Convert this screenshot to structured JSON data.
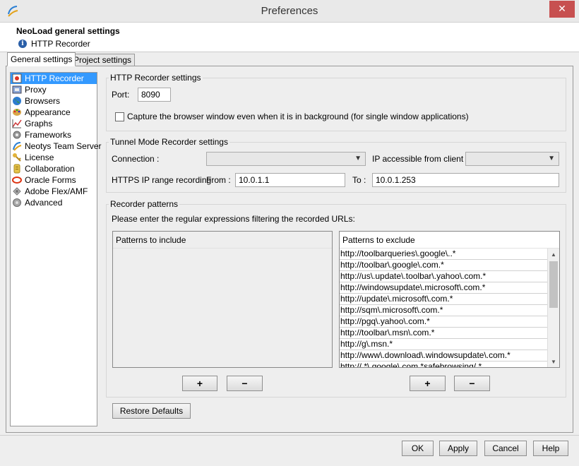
{
  "window": {
    "title": "Preferences",
    "close_glyph": "✕"
  },
  "header": {
    "title": "NeoLoad general settings",
    "subtitle": "HTTP Recorder",
    "info_icon": "i"
  },
  "tabs": [
    {
      "label": "General settings",
      "active": true
    },
    {
      "label": "Project settings",
      "active": false
    }
  ],
  "sidebar": {
    "items": [
      {
        "label": "HTTP Recorder",
        "icon": "recorder-icon",
        "selected": true
      },
      {
        "label": "Proxy",
        "icon": "proxy-icon"
      },
      {
        "label": "Browsers",
        "icon": "globe-icon"
      },
      {
        "label": "Appearance",
        "icon": "palette-icon"
      },
      {
        "label": "Graphs",
        "icon": "graph-icon"
      },
      {
        "label": "Frameworks",
        "icon": "gear-icon"
      },
      {
        "label": "Neotys Team Server",
        "icon": "neotys-icon"
      },
      {
        "label": "License",
        "icon": "key-icon"
      },
      {
        "label": "Collaboration",
        "icon": "collaboration-icon"
      },
      {
        "label": "Oracle Forms",
        "icon": "oracle-icon"
      },
      {
        "label": "Adobe Flex/AMF",
        "icon": "flex-icon"
      },
      {
        "label": "Advanced",
        "icon": "advanced-gear-icon"
      }
    ]
  },
  "http_recorder": {
    "title": "HTTP Recorder settings",
    "port_label": "Port:",
    "port_value": "8090",
    "capture_label": "Capture the browser window even when it is in background (for single window applications)",
    "capture_checked": false
  },
  "tunnel": {
    "title": "Tunnel Mode Recorder settings",
    "connection_label": "Connection :",
    "ip_accessible_label": "IP accessible from client :",
    "https_label": "HTTPS IP range recording",
    "from_label": "From :",
    "from_value": "10.0.1.1",
    "to_label": "To :",
    "to_value": "10.0.1.253"
  },
  "patterns": {
    "title": "Recorder patterns",
    "instruction": "Please enter the regular expressions filtering the recorded URLs:",
    "include_header": "Patterns to include",
    "exclude_header": "Patterns to exclude",
    "exclude": [
      "http://toolbarqueries\\.google\\..*",
      "http://toolbar\\.google\\.com.*",
      "http://us\\.update\\.toolbar\\.yahoo\\.com.*",
      "http://windowsupdate\\.microsoft\\.com.*",
      "http://update\\.microsoft\\.com.*",
      "http://sqm\\.microsoft\\.com.*",
      "http://pgq\\.yahoo\\.com.*",
      "http://toolbar\\.msn\\.com.*",
      "http://g\\.msn.*",
      "http://www\\.download\\.windowsupdate\\.com.*",
      "http://.*\\.google\\.com.*safebrowsing/.*"
    ],
    "add_label": "+",
    "remove_label": "−"
  },
  "restore_defaults_label": "Restore Defaults",
  "footer": {
    "ok": "OK",
    "apply": "Apply",
    "cancel": "Cancel",
    "help": "Help"
  },
  "colors": {
    "selection": "#3399ff",
    "close_button": "#c75050"
  }
}
